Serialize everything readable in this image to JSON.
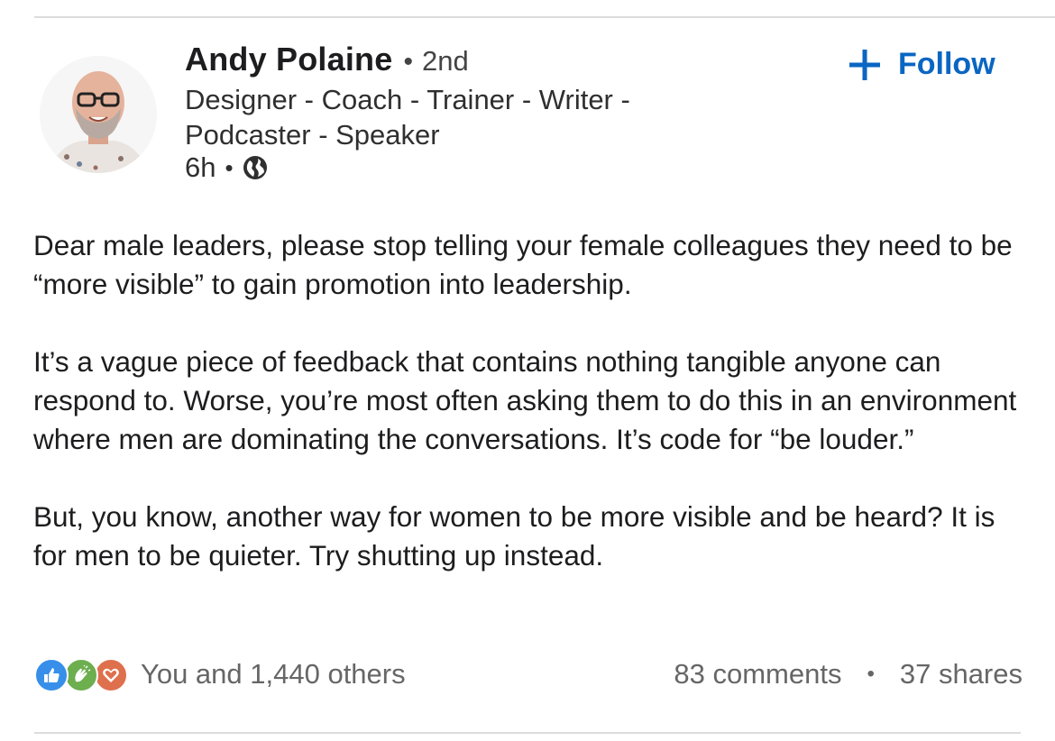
{
  "post": {
    "author": {
      "name": "Andy Polaine",
      "degree": "2nd",
      "headline": "Designer - Coach - Trainer - Writer - Podcaster - Speaker",
      "time": "6h",
      "avatar_icon": "profile-photo",
      "visibility_icon": "globe-icon"
    },
    "follow": {
      "label": "Follow",
      "icon": "plus-icon"
    },
    "body": {
      "paragraphs": [
        "Dear male leaders, please stop telling your female colleagues they need to be “more visible” to gain promotion into leadership.",
        "It’s a vague piece of feedback that contains nothing tangible anyone can respond to. Worse, you’re most often asking them to do this in an environment where men are dominating the conversations. It’s code for “be louder.”",
        "But, you know, another way for women to be more visible and be heard? It is for men to be quieter. Try shutting up instead."
      ]
    },
    "social": {
      "reactions_text": "You and 1,440 others",
      "reaction_icons": [
        "like-icon",
        "celebrate-icon",
        "love-icon"
      ],
      "comments": "83 comments",
      "shares": "37 shares"
    }
  },
  "colors": {
    "accent": "#0a66c2",
    "like": "#378fe9",
    "celebrate": "#6dae4f",
    "love": "#df704d",
    "muted_text": "#666666"
  }
}
